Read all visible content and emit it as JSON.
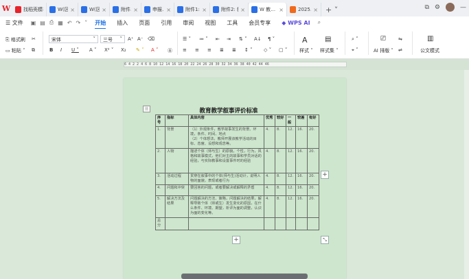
{
  "tabs": [
    {
      "label": "找稻壳模板",
      "color": "#e8232b"
    },
    {
      "label": "W(区…",
      "color": "#2b6fe6"
    },
    {
      "label": "W(区…",
      "color": "#2b6fe6"
    },
    {
      "label": "附件…",
      "color": "#2b6fe6"
    },
    {
      "label": "申报…",
      "color": "#2b6fe6"
    },
    {
      "label": "附件1: 需…",
      "color": "#2b6fe6"
    },
    {
      "label": "附件2: 教…",
      "color": "#2b6fe6"
    },
    {
      "label": "W 教…",
      "color": "#2b6fe6"
    },
    {
      "label": "2025…",
      "color": "#f06a1e"
    }
  ],
  "menu": {
    "file": "文件",
    "items": [
      "开始",
      "插入",
      "页面",
      "引用",
      "审阅",
      "视图",
      "工具",
      "会员专享"
    ],
    "wps_ai": "WPS AI"
  },
  "ribbon": {
    "format_painter": "格式刷",
    "paste": "粘贴",
    "font_name": "宋体",
    "font_size": "三号",
    "styles": "样式",
    "styles_set": "样式集",
    "ai_layout": "AI 排版",
    "doc_format": "公文模式"
  },
  "ruler_text": "6  4  2     2  4  6  8  10  12  14  16  18  20  22  24  26  28  30  32  34  36  38  40  42  44  46",
  "document": {
    "title": "教育教学叙事评价标准",
    "headers": [
      "序号",
      "指标",
      "具体内容",
      "优秀",
      "较好",
      "一般",
      "较差",
      "有好"
    ],
    "rows": [
      {
        "no": "1.",
        "item": "背景",
        "content": "（1）外观条件，教学故事发生的背景、环境，条件、时间、地点\n（2）个体想法，教师开展该教学活动的目标、态度、设想和观念等。",
        "v": [
          "4.",
          "8.",
          "12.",
          "16.",
          "20."
        ]
      },
      {
        "no": "2.",
        "item": "人物",
        "content": "描述个体（师与生）的原貌，个性，行为，风格和故事模式，他们对主的故事和学员对话的经验，与实际教事和设置事件时的经验",
        "v": [
          "4.",
          "8.",
          "12.",
          "16.",
          "20."
        ]
      },
      {
        "no": "3.",
        "item": "活动过程",
        "content": "贯穿在叙事中的个体(师与生)活动计，说明人物的面貌，表现或者行为",
        "v": [
          "4.",
          "8.",
          "12.",
          "16.",
          "20."
        ]
      },
      {
        "no": "4.",
        "item": "问题和冲突",
        "content": "要回答的问题，或者要解决或解释的矛盾",
        "v": [
          "4.",
          "8.",
          "12.",
          "16.",
          "20."
        ]
      },
      {
        "no": "5.",
        "item": "解决方法及结果",
        "content": "问题解决的方法、策略，问题解决的结果，解释导致个体（师或生）发生变化的原因，在什么条件、环境、期望，析评为面的调整，认识为面的变化等。",
        "v": [
          "4.",
          "8.",
          "12.",
          "16.",
          "20."
        ]
      },
      {
        "no": "总分",
        "item": "",
        "content": "",
        "v": [
          "",
          "",
          "",
          "",
          ""
        ]
      }
    ]
  }
}
